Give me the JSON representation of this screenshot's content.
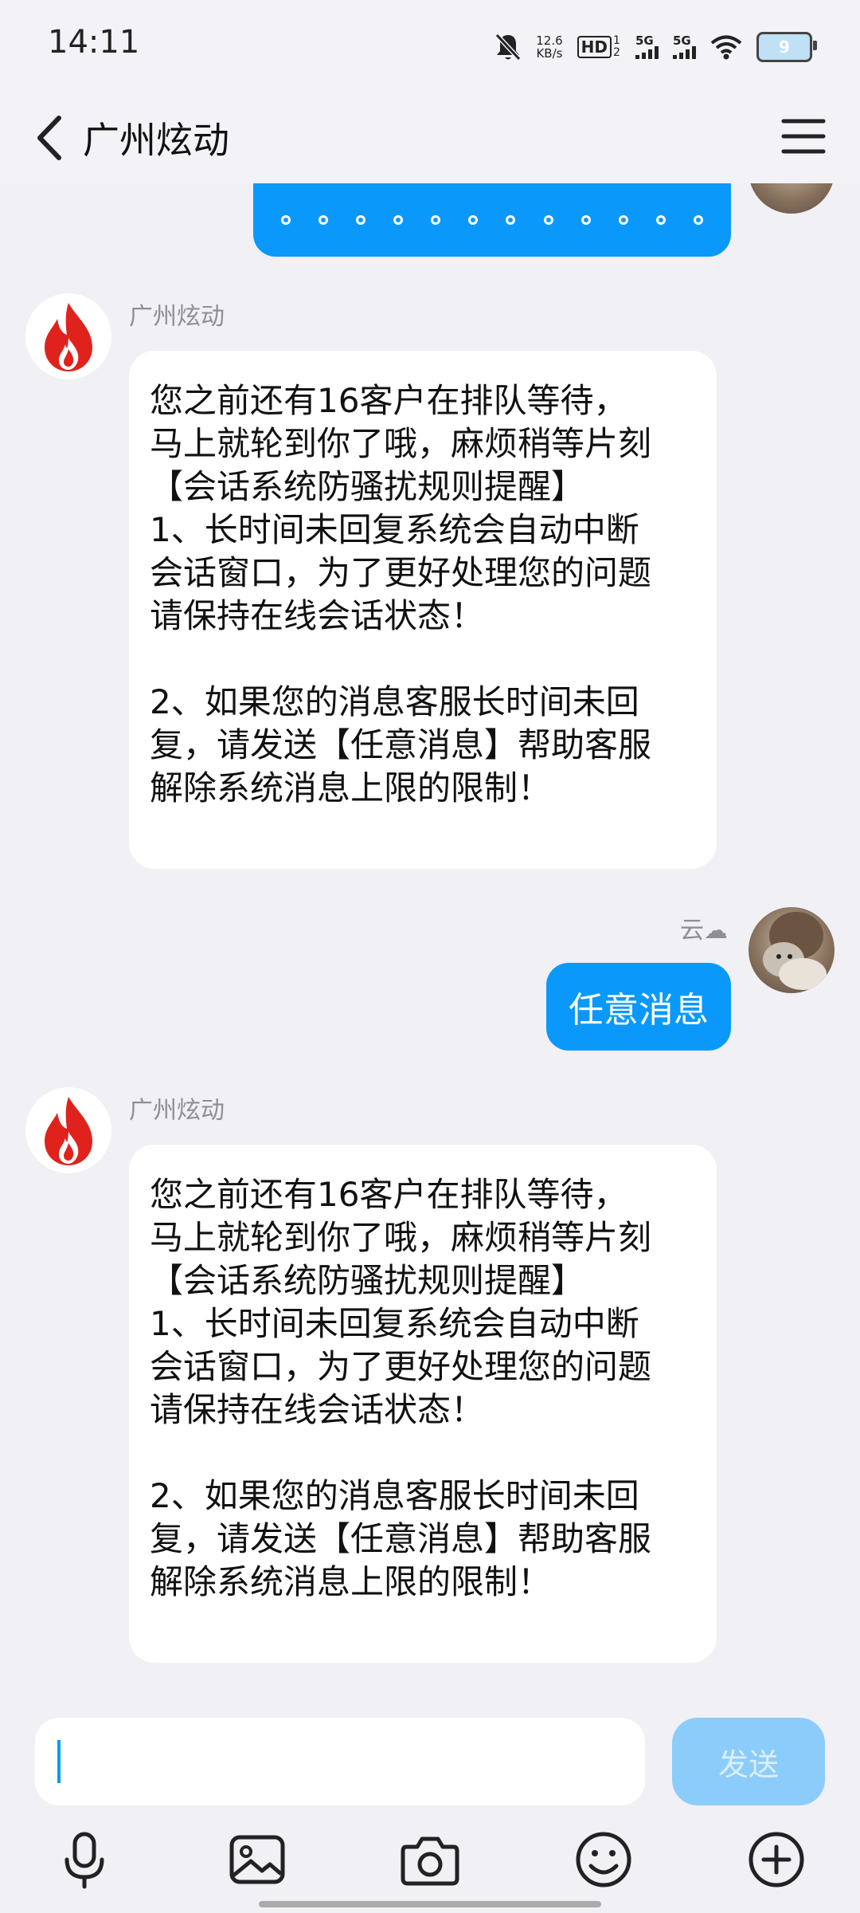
{
  "status_bar": {
    "time": "14:11",
    "net_speed_value": "12.6",
    "net_speed_unit": "KB/s",
    "hd_label": "HD",
    "hd_sub": "1 2",
    "sim1_label": "5G",
    "sim2_label": "5G",
    "battery_level": "9"
  },
  "header": {
    "title": "广州炫动"
  },
  "messages": [
    {
      "sender": "广州炫动",
      "text": "您之前还有16客户在排队等待，\n马上就轮到你了哦，麻烦稍等片刻\n【会话系统防骚扰规则提醒】\n1、长时间未回复系统会自动中断\n会话窗口，为了更好处理您的问题\n请保持在线会话状态！\n\n2、如果您的消息客服长时间未回\n复，请发送【任意消息】帮助客服\n解除系统消息上限的限制！"
    },
    {
      "sender": "云☁",
      "text": "任意消息"
    },
    {
      "sender": "广州炫动",
      "text": "您之前还有16客户在排队等待，\n马上就轮到你了哦，麻烦稍等片刻\n【会话系统防骚扰规则提醒】\n1、长时间未回复系统会自动中断\n会话窗口，为了更好处理您的问题\n请保持在线会话状态！\n\n2、如果您的消息客服长时间未回\n复，请发送【任意消息】帮助客服\n解除系统消息上限的限制！"
    }
  ],
  "input": {
    "value": "",
    "send_label": "发送"
  },
  "toolbar": [
    "microphone-icon",
    "image-icon",
    "camera-icon",
    "emoji-icon",
    "plus-icon"
  ],
  "colors": {
    "accent": "#0a99fb",
    "send_disabled": "#8cccfa",
    "background": "#f0f0f5",
    "flame_red": "#e0221c"
  }
}
